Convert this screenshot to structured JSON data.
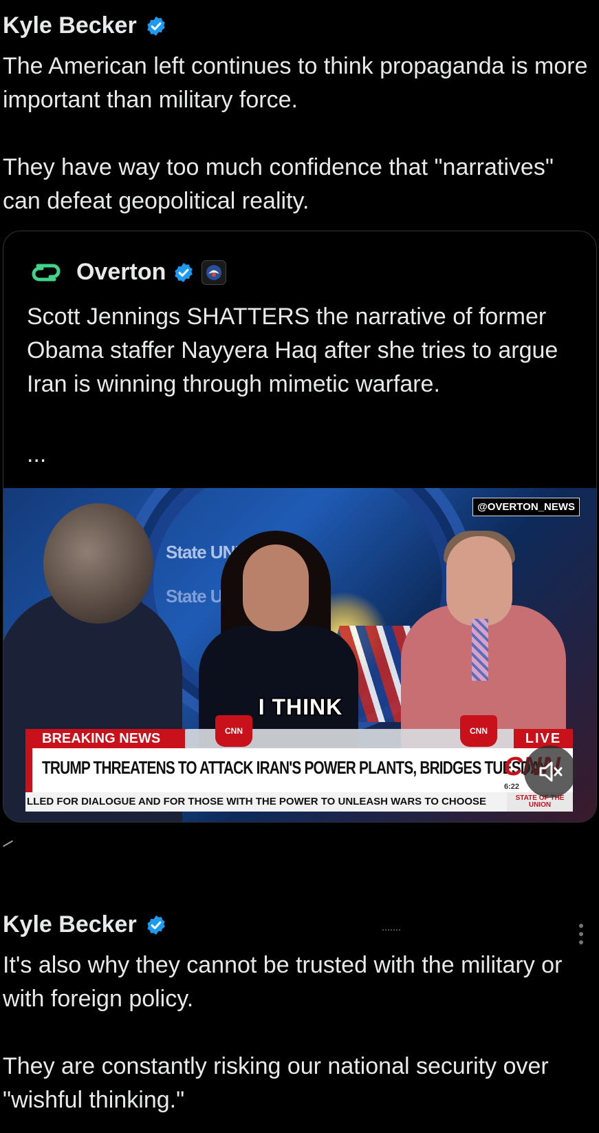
{
  "tweet1": {
    "author": "Kyle Becker",
    "text": "The American left continues to think propaganda is more important than military force.\n\nThey have way too much confidence that \"narratives\" can defeat geopolitical reality."
  },
  "quote": {
    "author": "Overton",
    "text": "Scott Jennings SHATTERS the narrative of former Obama staffer Nayyera Haq after she tries to argue Iran is winning through mimetic warfare.",
    "ellipsis": "...",
    "media": {
      "handle_tag": "@OVERTON_NEWS",
      "sotu_1": "State UNION",
      "caption": "I THINK",
      "breaking": "BREAKING NEWS",
      "live": "LIVE",
      "headline": "TRUMP THREATENS TO ATTACK IRAN'S POWER PLANTS, BRIDGES TUESDAY",
      "network": "CNN",
      "time": "6:22",
      "ticker": "LLED FOR DIALOGUE AND FOR THOSE WITH THE POWER TO UNLEASH WARS TO CHOOSE",
      "program": "STATE OF THE UNION",
      "mug_label": "CNN"
    }
  },
  "tweet2": {
    "author": "Kyle Becker",
    "text": "It's also why they cannot be trusted with the military or with foreign policy.\n\nThey are constantly risking our national security over \"wishful thinking.\""
  },
  "colors": {
    "background": "#000000",
    "text": "#e7e9ea",
    "verified": "#1d9bf0",
    "cnn_red": "#c8111a",
    "overton_green": "#3fd48a"
  },
  "icons": {
    "verified": "verified-badge-icon",
    "mute": "volume-muted-icon",
    "more": "more-vertical-icon"
  }
}
